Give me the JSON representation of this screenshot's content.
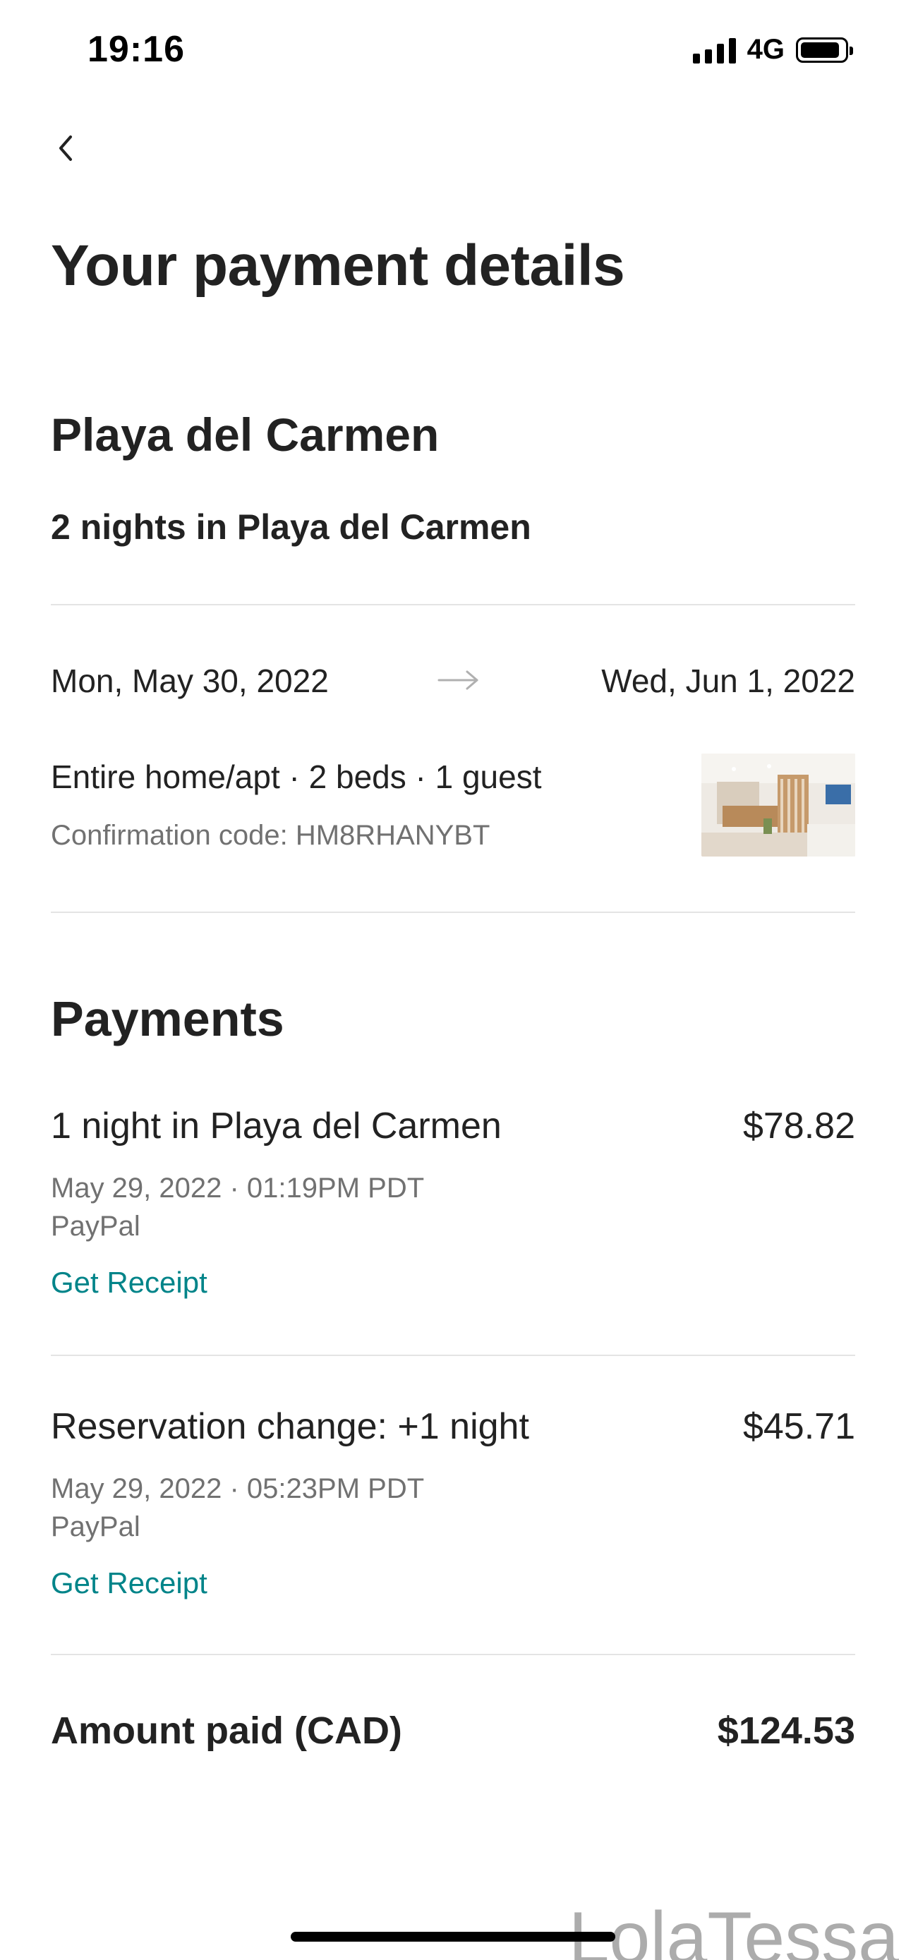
{
  "status_bar": {
    "time": "19:16",
    "network": "4G"
  },
  "header": {
    "back_icon": "chevron-left-icon",
    "title": "Your payment details"
  },
  "listing": {
    "city": "Playa del Carmen",
    "subtitle": "2 nights in Playa del Carmen",
    "check_in": "Mon, May 30, 2022",
    "check_out": "Wed, Jun 1, 2022",
    "stay_info": "Entire home/apt · 2 beds · 1 guest",
    "confirmation": "Confirmation code: HM8RHANYBT"
  },
  "payments": {
    "title": "Payments",
    "items": [
      {
        "description": "1 night in Playa del Carmen",
        "amount": "$78.82",
        "date": "May 29, 2022 · 01:19PM PDT",
        "method": "PayPal",
        "receipt_label": "Get Receipt"
      },
      {
        "description": "Reservation change: +1 night",
        "amount": "$45.71",
        "date": "May 29, 2022 · 05:23PM PDT",
        "method": "PayPal",
        "receipt_label": "Get Receipt"
      }
    ]
  },
  "total": {
    "label": "Amount paid (CAD)",
    "amount": "$124.53"
  },
  "watermark": "LolaTessa",
  "colors": {
    "link": "#008489",
    "text": "#222222",
    "muted": "#717171",
    "divider": "#e4e4e4"
  }
}
